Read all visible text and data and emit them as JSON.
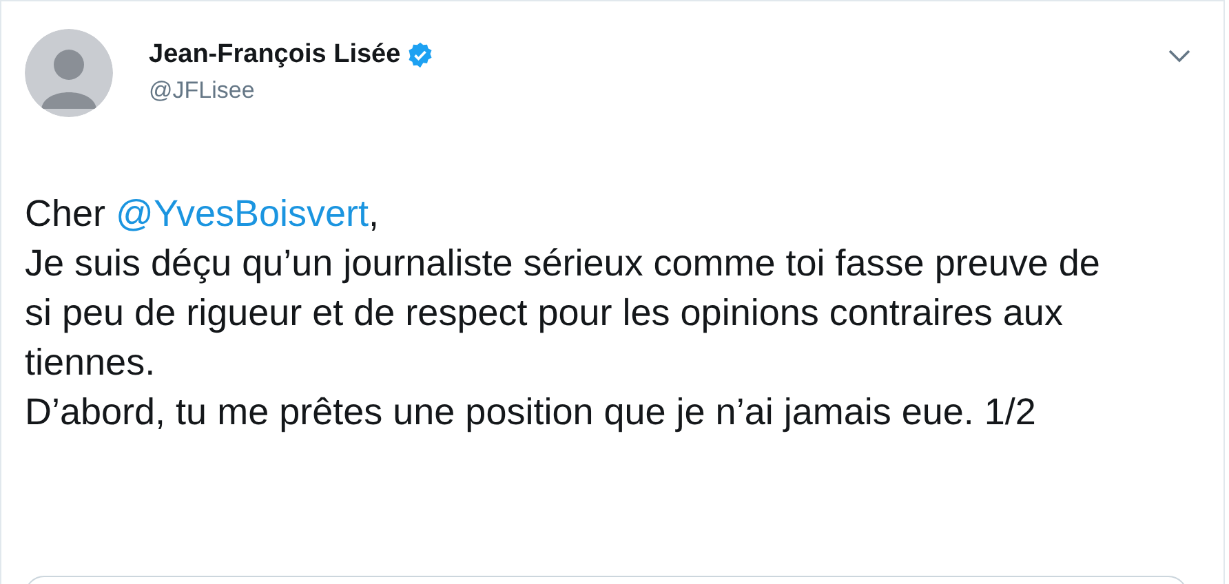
{
  "author": {
    "name": "Jean-François Lisée",
    "verified": true,
    "handle": "@JFLisee"
  },
  "body": {
    "greeting": {
      "prefix": "Cher ",
      "mention": "@YvesBoisvert",
      "suffix": ","
    },
    "paragraphs": [
      "Je suis déçu qu’un journaliste sérieux comme toi fasse preuve de si peu de rigueur et de respect pour les opinions contraires aux tiennes.",
      "D’abord, tu me prêtes une position que je n’ai jamais eue. 1/2"
    ]
  }
}
